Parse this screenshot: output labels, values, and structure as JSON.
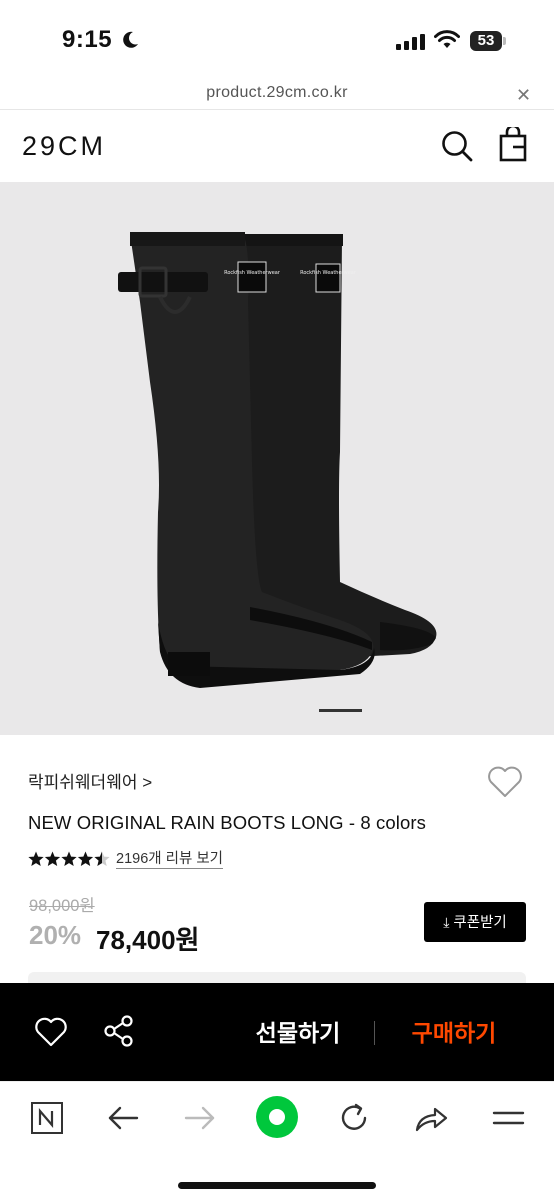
{
  "status_bar": {
    "time": "9:15",
    "battery_level": "53"
  },
  "browser": {
    "url": "product.29cm.co.kr"
  },
  "site": {
    "logo": "29CM"
  },
  "product": {
    "brand": "락피쉬웨더웨어 >",
    "name": "NEW ORIGINAL RAIN BOOTS LONG - 8 colors",
    "rating": 4.5,
    "review_link": "2196개 리뷰 보기",
    "original_price": "98,000원",
    "discount": "20%",
    "sale_price": "78,400원",
    "coupon_button": "쿠폰받기",
    "image_brand_label": "Rockfish Weatherwear"
  },
  "action_bar": {
    "gift": "선물하기",
    "buy": "구매하기"
  },
  "colors": {
    "buy": "#ff4800",
    "action_bar_bg": "#000000",
    "image_bg": "#e9e8e9",
    "new_tab": "#00c73c"
  },
  "icons": [
    "moon-icon",
    "signal-icon",
    "wifi-icon",
    "close-icon",
    "search-icon",
    "shopping-bag-icon",
    "heart-icon",
    "star-icon",
    "download-icon",
    "share-icon",
    "naver-icon",
    "back-arrow-icon",
    "forward-arrow-icon",
    "green-dot-icon",
    "refresh-icon",
    "share-arrow-icon",
    "menu-icon"
  ]
}
